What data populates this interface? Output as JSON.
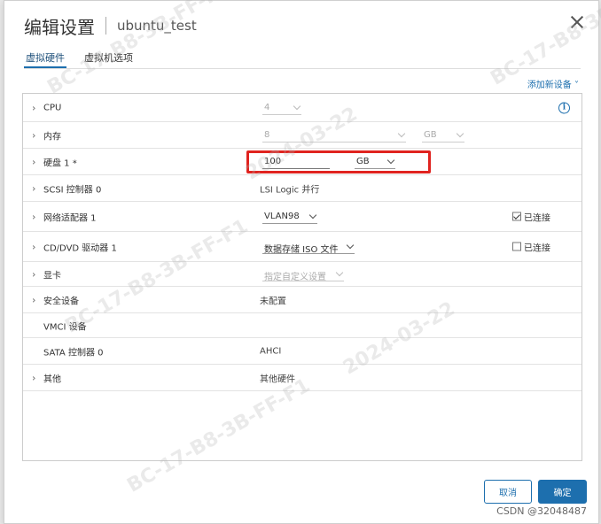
{
  "dialog": {
    "title": "编辑设置",
    "subtitle": "ubuntu_test",
    "tabs": [
      {
        "label": "虚拟硬件",
        "active": true
      },
      {
        "label": "虚拟机选项",
        "active": false
      }
    ],
    "add_device": "添加新设备 ˅",
    "rows": {
      "cpu": {
        "label": "CPU",
        "value": "4"
      },
      "memory": {
        "label": "内存",
        "value": "8",
        "unit": "GB"
      },
      "disk": {
        "label": "硬盘 1 *",
        "value": "100",
        "unit": "GB"
      },
      "scsi": {
        "label": "SCSI 控制器 0",
        "value": "LSI Logic 并行"
      },
      "network": {
        "label": "网络适配器 1",
        "value": "VLAN98",
        "connected_label": "已连接",
        "connected": true
      },
      "cdrom": {
        "label": "CD/DVD 驱动器 1",
        "value": "数据存储 ISO 文件",
        "connected_label": "已连接",
        "connected": false
      },
      "video": {
        "label": "显卡",
        "value": "指定自定义设置"
      },
      "security": {
        "label": "安全设备",
        "value": "未配置"
      },
      "vmci": {
        "label": "VMCI 设备",
        "value": ""
      },
      "sata": {
        "label": "SATA 控制器 0",
        "value": "AHCI"
      },
      "other": {
        "label": "其他",
        "value": "其他硬件"
      }
    },
    "buttons": {
      "cancel": "取消",
      "ok": "确定"
    }
  },
  "watermark_text": "BC-17-B8-3B-FF-F1",
  "watermark_date": "2024-03-22",
  "footer_credit": "CSDN @32048487",
  "colors": {
    "accent": "#1d6fae",
    "highlight": "#e0231f"
  }
}
